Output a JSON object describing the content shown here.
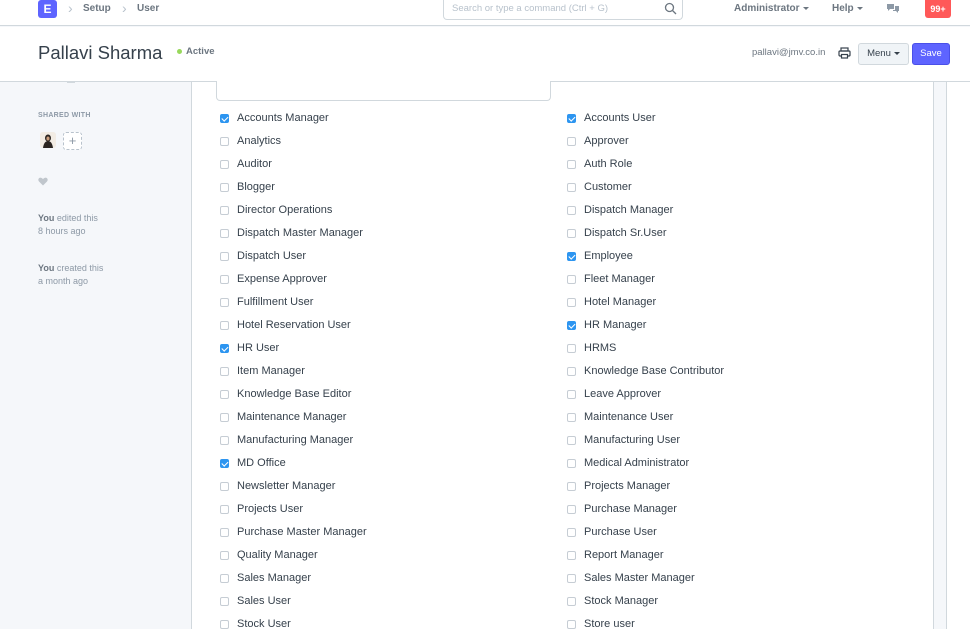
{
  "navbar": {
    "brand": "E",
    "breadcrumbs": [
      "Setup",
      "User"
    ],
    "search_placeholder": "Search or type a command (Ctrl + G)",
    "user_menu": "Administrator",
    "help_menu": "Help",
    "notifications": "99+"
  },
  "page": {
    "title": "Pallavi Sharma",
    "status": "Active",
    "email": "pallavi@jmv.co.in",
    "menu_label": "Menu",
    "save_label": "Save"
  },
  "sidebar": {
    "shared_with_label": "SHARED WITH",
    "add_share": "+",
    "activity": [
      {
        "actor": "You",
        "action": " edited this",
        "time": "8 hours ago"
      },
      {
        "actor": "You",
        "action": " created this",
        "time": "a month ago"
      }
    ]
  },
  "roles_left": [
    {
      "label": "Accounts Manager",
      "checked": true
    },
    {
      "label": "Analytics",
      "checked": false
    },
    {
      "label": "Auditor",
      "checked": false
    },
    {
      "label": "Blogger",
      "checked": false
    },
    {
      "label": "Director Operations",
      "checked": false
    },
    {
      "label": "Dispatch Master Manager",
      "checked": false
    },
    {
      "label": "Dispatch User",
      "checked": false
    },
    {
      "label": "Expense Approver",
      "checked": false
    },
    {
      "label": "Fulfillment User",
      "checked": false
    },
    {
      "label": "Hotel Reservation User",
      "checked": false
    },
    {
      "label": "HR User",
      "checked": true
    },
    {
      "label": "Item Manager",
      "checked": false
    },
    {
      "label": "Knowledge Base Editor",
      "checked": false
    },
    {
      "label": "Maintenance Manager",
      "checked": false
    },
    {
      "label": "Manufacturing Manager",
      "checked": false
    },
    {
      "label": "MD Office",
      "checked": true
    },
    {
      "label": "Newsletter Manager",
      "checked": false
    },
    {
      "label": "Projects User",
      "checked": false
    },
    {
      "label": "Purchase Master Manager",
      "checked": false
    },
    {
      "label": "Quality Manager",
      "checked": false
    },
    {
      "label": "Sales Manager",
      "checked": false
    },
    {
      "label": "Sales User",
      "checked": false
    },
    {
      "label": "Stock User",
      "checked": false
    }
  ],
  "roles_right": [
    {
      "label": "Accounts User",
      "checked": true
    },
    {
      "label": "Approver",
      "checked": false
    },
    {
      "label": "Auth Role",
      "checked": false
    },
    {
      "label": "Customer",
      "checked": false
    },
    {
      "label": "Dispatch Manager",
      "checked": false
    },
    {
      "label": "Dispatch Sr.User",
      "checked": false
    },
    {
      "label": "Employee",
      "checked": true
    },
    {
      "label": "Fleet Manager",
      "checked": false
    },
    {
      "label": "Hotel Manager",
      "checked": false
    },
    {
      "label": "HR Manager",
      "checked": true
    },
    {
      "label": "HRMS",
      "checked": false
    },
    {
      "label": "Knowledge Base Contributor",
      "checked": false
    },
    {
      "label": "Leave Approver",
      "checked": false
    },
    {
      "label": "Maintenance User",
      "checked": false
    },
    {
      "label": "Manufacturing User",
      "checked": false
    },
    {
      "label": "Medical Administrator",
      "checked": false
    },
    {
      "label": "Projects Manager",
      "checked": false
    },
    {
      "label": "Purchase Manager",
      "checked": false
    },
    {
      "label": "Purchase User",
      "checked": false
    },
    {
      "label": "Report Manager",
      "checked": false
    },
    {
      "label": "Sales Master Manager",
      "checked": false
    },
    {
      "label": "Stock Manager",
      "checked": false
    },
    {
      "label": "Store user",
      "checked": false
    }
  ]
}
